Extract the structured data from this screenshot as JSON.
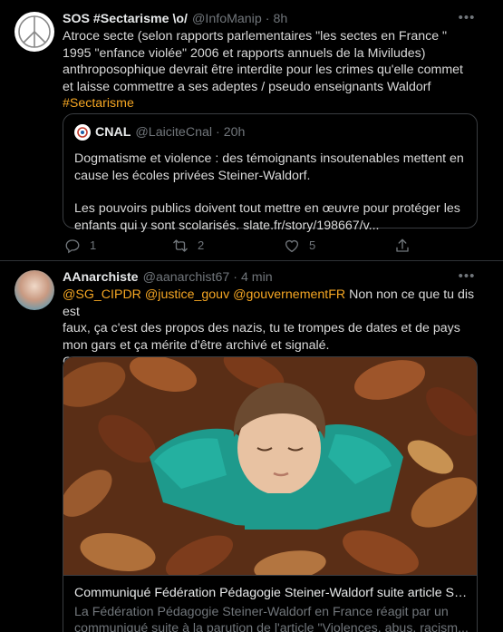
{
  "tweet1": {
    "name": "SOS #Sectarisme \\o/",
    "handle": "@InfoManip",
    "time": "8h",
    "text_lines": [
      "Atroce secte (selon rapports parlementaires \"les sectes en France \"",
      "1995 \"enfance violée\" 2006 et rapports annuels de la Miviludes)",
      "anthroposophique devrait être interdite pour les crimes qu'elle commet",
      "et laisse commettre a ses adeptes / pseudo enseignants Waldorf"
    ],
    "hashtag": "#Sectarisme",
    "quote": {
      "name": "CNAL",
      "handle": "@LaiciteCnal",
      "time": "20h",
      "para1_lines": [
        "Dogmatisme et violence : des témoignants insoutenables mettent en",
        "cause les écoles privées Steiner-Waldorf."
      ],
      "para2_lines": [
        "Les pouvoirs publics doivent tout mettre en œuvre pour protéger les",
        "enfants qui y sont scolarisés. slate.fr/story/198667/v..."
      ]
    },
    "actions": {
      "replies": "1",
      "retweets": "2",
      "likes": "5"
    }
  },
  "tweet2": {
    "name": "AAnarchiste",
    "handle": "@aanarchist67",
    "time": "4 min",
    "mentions": [
      "@SG_CIPDR",
      "@justice_gouv",
      "@gouvernementFR"
    ],
    "text_first": "Non non ce que tu dis est",
    "text_lines": [
      "faux, ça c'est des propos des nazis, tu te trompes de dates et de pays",
      "mon gars et ça mérite d'être archivé et signalé.",
      "Cela dit:"
    ],
    "card": {
      "title": "Communiqué Fédération Pédagogie Steiner-Waldorf suite article Sla...",
      "desc_lines": [
        "La Fédération Pédagogie Steiner-Waldorf en France réagit par un",
        "communiqué suite à la parution de l'article \"Violences, abus, racism..."
      ]
    }
  },
  "colors": {
    "hashtag": "#f5a623",
    "muted": "#71767b",
    "border": "#3a3d41",
    "background": "#000000"
  },
  "icons": [
    "peace-icon",
    "more-icon",
    "reply-icon",
    "retweet-icon",
    "like-icon",
    "share-icon"
  ]
}
